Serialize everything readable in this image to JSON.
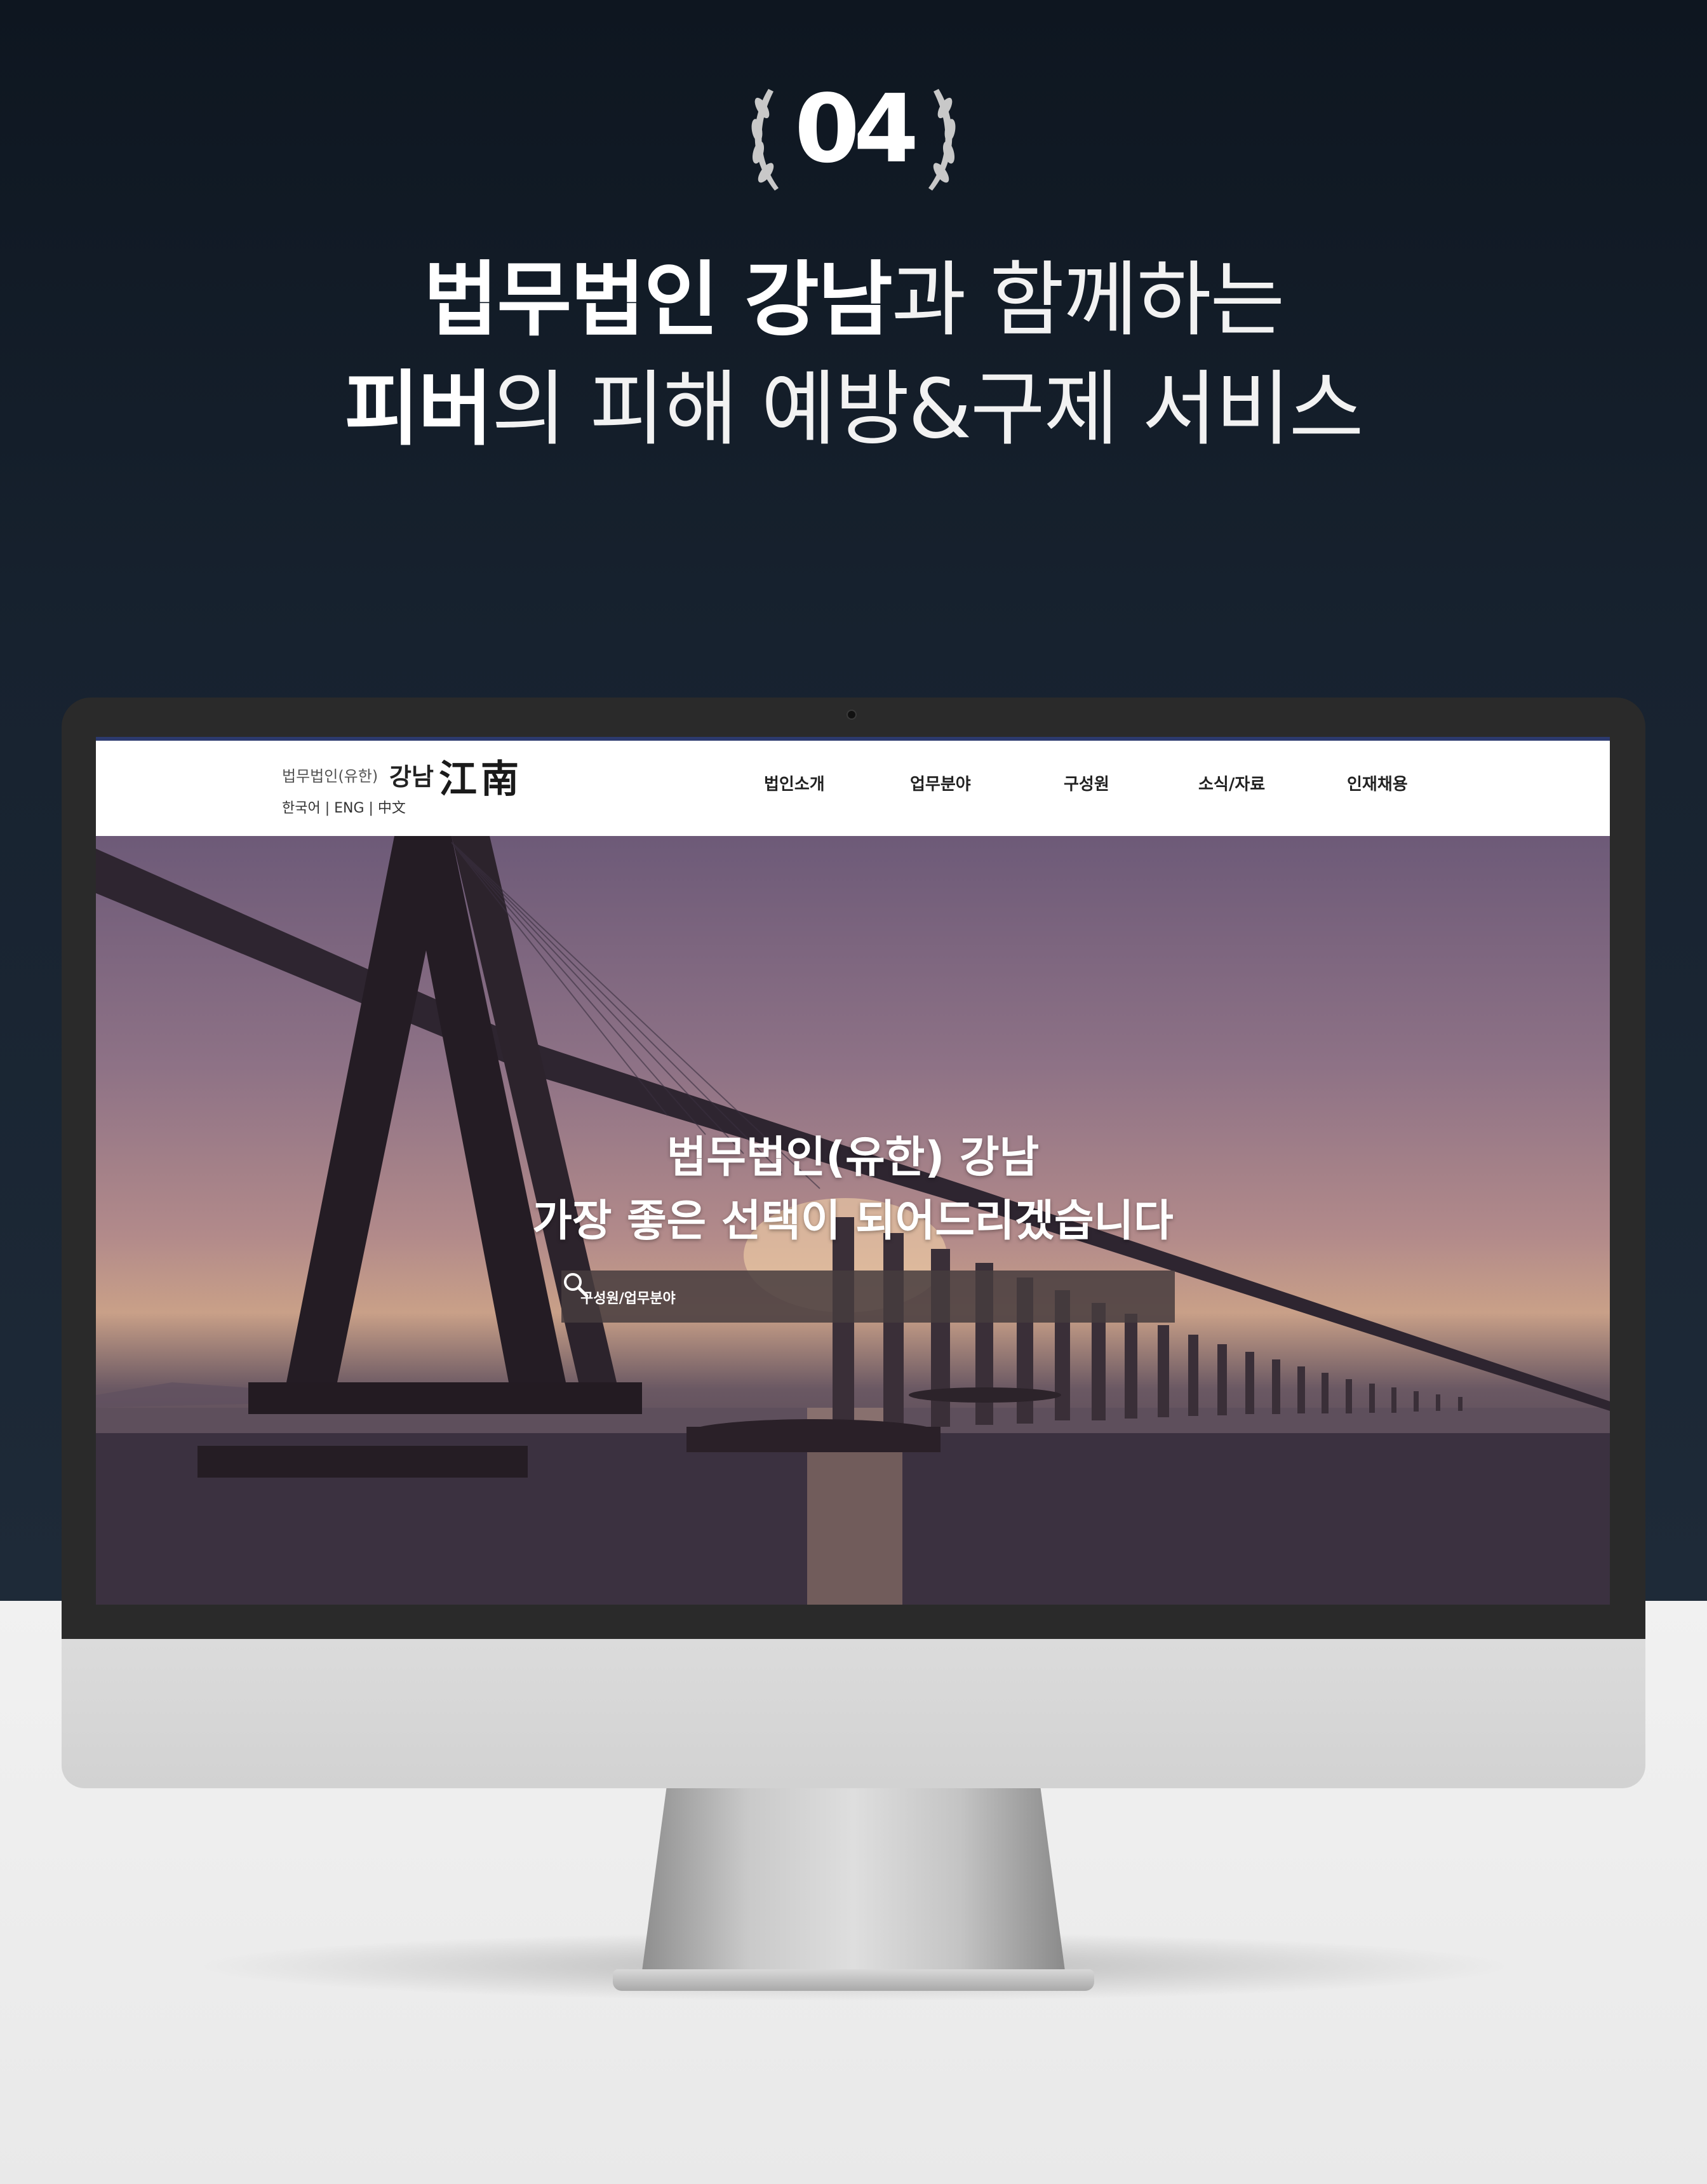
{
  "badge": {
    "number": "04"
  },
  "headline": {
    "line1_strong": "법무법인 강남",
    "line1_light": "과 함께하는",
    "line2_strong": "피버",
    "line2_light": "의 피해 예방&구제 서비스"
  },
  "site": {
    "logo_small": "법무법인(유한)",
    "logo_ko": "강남",
    "logo_hanja": "江南",
    "languages": "한국어 | ENG | 中文",
    "nav": [
      "법인소개",
      "업무분야",
      "구성원",
      "소식/자료",
      "인재채용"
    ],
    "hero_line1": "법무법인(유한) 강남",
    "hero_line2": "가장 좋은 선택이 되어드리겠습니다",
    "search_placeholder": "구성원/업무분야"
  },
  "colors": {
    "header_border": "#2c3a6e",
    "bg_dark": "#17222f",
    "bg_light": "#ececec"
  }
}
